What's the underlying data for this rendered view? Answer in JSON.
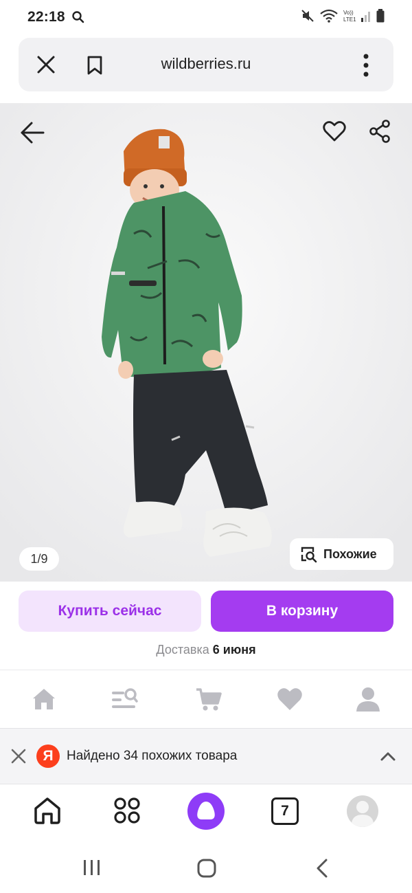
{
  "status": {
    "time": "22:18"
  },
  "browser": {
    "url": "wildberries.ru"
  },
  "product": {
    "pager": "1/9",
    "similar_label": "Похожие"
  },
  "actions": {
    "buy_now": "Купить сейчас",
    "add_to_cart": "В корзину"
  },
  "delivery": {
    "label": "Доставка",
    "date": "6 июня"
  },
  "site_nav": {
    "items": [
      "home-icon",
      "catalog-search-icon",
      "cart-icon",
      "favorites-icon",
      "profile-icon"
    ]
  },
  "suggestion": {
    "text": "Найдено 34 похожих товара",
    "logo_letter": "Я"
  },
  "toolbar": {
    "tabs_count": "7"
  },
  "colors": {
    "accent": "#a43cf0",
    "accent_light": "#f3e4fd",
    "yandex_red": "#fc3f1d",
    "alice": "#8e3cf7"
  }
}
